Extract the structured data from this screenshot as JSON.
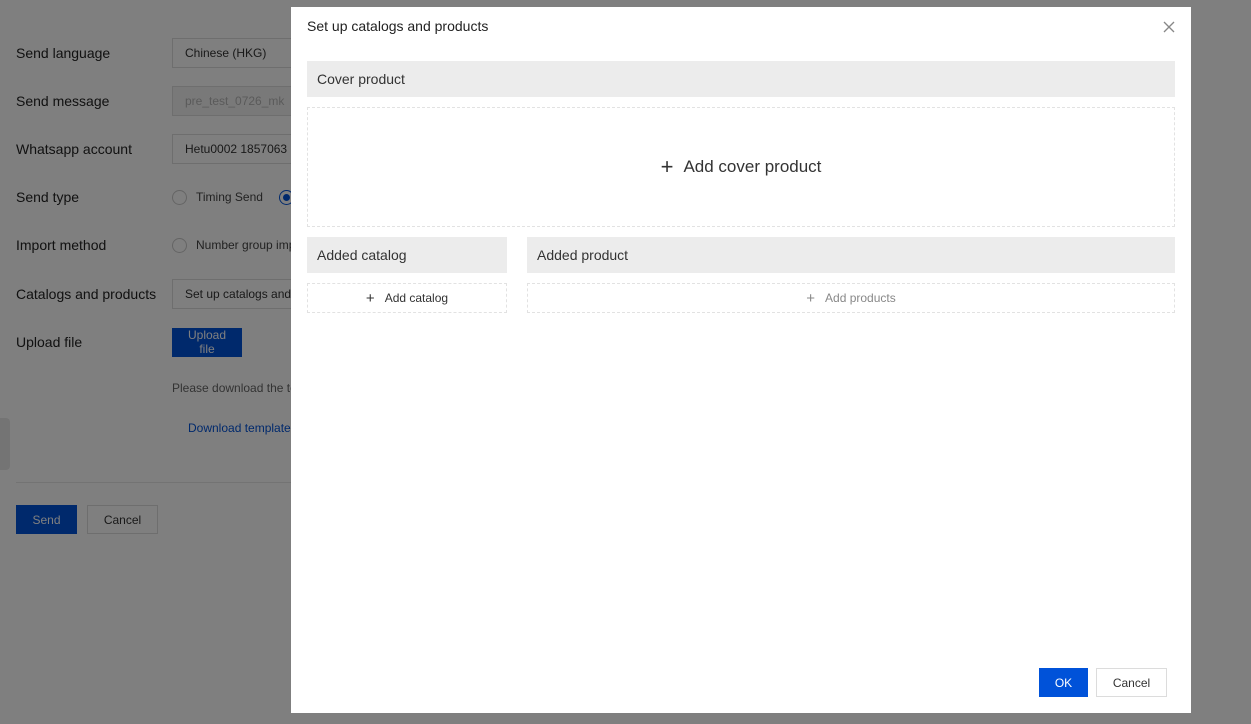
{
  "form": {
    "send_language": {
      "label": "Send language",
      "value": "Chinese (HKG)"
    },
    "send_message": {
      "label": "Send message",
      "value": "pre_test_0726_mk"
    },
    "whatsapp_account": {
      "label": "Whatsapp account",
      "value": "Hetu0002  1857063"
    },
    "send_type": {
      "label": "Send type",
      "options": [
        "Timing Send",
        ""
      ]
    },
    "import_method": {
      "label": "Import method",
      "options": [
        "Number group import"
      ]
    },
    "catalogs_products": {
      "label": "Catalogs and products",
      "value": "Set up catalogs and products"
    },
    "upload_file": {
      "label": "Upload file",
      "button": "Upload file"
    },
    "hint": "Please download the template",
    "download_link": "Download template",
    "send_button": "Send",
    "cancel_button": "Cancel"
  },
  "dialog": {
    "title": "Set up catalogs and products",
    "cover_product_header": "Cover product",
    "add_cover_product": "Add cover product",
    "added_catalog_header": "Added catalog",
    "add_catalog": "Add catalog",
    "added_product_header": "Added product",
    "add_products": "Add products",
    "ok_button": "OK",
    "cancel_button": "Cancel"
  },
  "colors": {
    "primary": "#0052d9",
    "overlay": "rgba(0,0,0,0.5)",
    "section_header_bg": "#ececec"
  }
}
